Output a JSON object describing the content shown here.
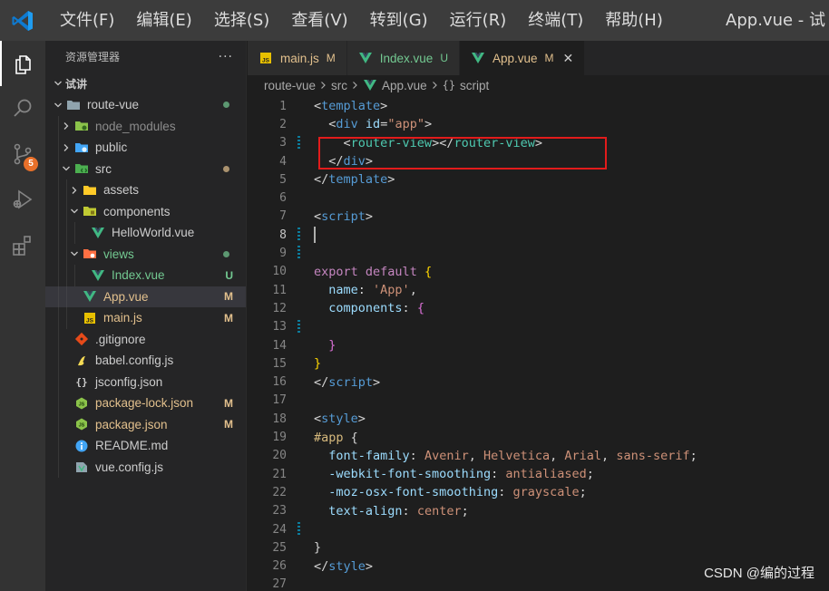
{
  "titlebar": {
    "menu": [
      "文件(F)",
      "编辑(E)",
      "选择(S)",
      "查看(V)",
      "转到(G)",
      "运行(R)",
      "终端(T)",
      "帮助(H)"
    ],
    "window_title": "App.vue - 试"
  },
  "activitybar": {
    "items": [
      "explorer-icon",
      "search-icon",
      "source-control-icon",
      "run-debug-icon",
      "extensions-icon"
    ],
    "scm_badge": "5"
  },
  "sidebar": {
    "title": "资源管理器",
    "more": "···",
    "workspace": "试讲",
    "tree": [
      {
        "label": "route-vue",
        "kind": "folder-open",
        "depth": 1,
        "icon": "folder-icon",
        "dot": "#73c991"
      },
      {
        "label": "node_modules",
        "kind": "folder",
        "depth": 2,
        "icon": "node-folder-icon",
        "dim": true
      },
      {
        "label": "public",
        "kind": "folder",
        "depth": 2,
        "icon": "public-folder-icon"
      },
      {
        "label": "src",
        "kind": "folder-open",
        "depth": 2,
        "icon": "src-folder-icon",
        "dot": "#e2c08d"
      },
      {
        "label": "assets",
        "kind": "folder",
        "depth": 3,
        "icon": "assets-folder-icon"
      },
      {
        "label": "components",
        "kind": "folder-open",
        "depth": 3,
        "icon": "components-folder-icon"
      },
      {
        "label": "HelloWorld.vue",
        "kind": "file",
        "depth": 4,
        "icon": "vue-file-icon"
      },
      {
        "label": "views",
        "kind": "folder-open",
        "depth": 3,
        "icon": "views-folder-icon",
        "git": "u",
        "dot": "#73c991"
      },
      {
        "label": "Index.vue",
        "kind": "file",
        "depth": 4,
        "icon": "vue-file-icon",
        "git": "u",
        "status": "U"
      },
      {
        "label": "App.vue",
        "kind": "file",
        "depth": 3,
        "icon": "vue-file-icon",
        "git": "m",
        "status": "M",
        "selected": true
      },
      {
        "label": "main.js",
        "kind": "file",
        "depth": 3,
        "icon": "js-file-icon",
        "git": "m",
        "status": "M"
      },
      {
        "label": ".gitignore",
        "kind": "file",
        "depth": 2,
        "icon": "git-file-icon"
      },
      {
        "label": "babel.config.js",
        "kind": "file",
        "depth": 2,
        "icon": "babel-file-icon"
      },
      {
        "label": "jsconfig.json",
        "kind": "file",
        "depth": 2,
        "icon": "json-file-icon"
      },
      {
        "label": "package-lock.json",
        "kind": "file",
        "depth": 2,
        "icon": "npm-file-icon",
        "git": "m",
        "status": "M"
      },
      {
        "label": "package.json",
        "kind": "file",
        "depth": 2,
        "icon": "npm-file-icon",
        "git": "m",
        "status": "M"
      },
      {
        "label": "README.md",
        "kind": "file",
        "depth": 2,
        "icon": "info-file-icon"
      },
      {
        "label": "vue.config.js",
        "kind": "file",
        "depth": 2,
        "icon": "vue-config-file-icon"
      }
    ]
  },
  "tabs": [
    {
      "label": "main.js",
      "icon": "js-file-icon",
      "status": "M",
      "git": "m"
    },
    {
      "label": "Index.vue",
      "icon": "vue-file-icon",
      "status": "U",
      "git": "u"
    },
    {
      "label": "App.vue",
      "icon": "vue-file-icon",
      "status": "M",
      "git": "m",
      "active": true,
      "close": "✕"
    }
  ],
  "breadcrumb": [
    "route-vue",
    "src",
    "App.vue",
    "script"
  ],
  "editor": {
    "current_line": 8,
    "lines": [
      [
        [
          "tok-br",
          "<"
        ],
        [
          "tok-tag",
          "template"
        ],
        [
          "tok-br",
          ">"
        ]
      ],
      [
        [
          "",
          "  "
        ],
        [
          "tok-br",
          "<"
        ],
        [
          "tok-tag",
          "div"
        ],
        [
          "",
          ""
        ],
        [
          "tok-attr",
          " id"
        ],
        [
          "tok-br",
          "="
        ],
        [
          "tok-str",
          "\"app\""
        ],
        [
          "tok-br",
          ">"
        ]
      ],
      [
        [
          "",
          "    "
        ],
        [
          "tok-br",
          "<"
        ],
        [
          "tok-tag2",
          "router-view"
        ],
        [
          "tok-br",
          "></"
        ],
        [
          "tok-tag2",
          "router-view"
        ],
        [
          "tok-br",
          ">"
        ]
      ],
      [
        [
          "",
          "  "
        ],
        [
          "tok-br",
          "</"
        ],
        [
          "tok-tag",
          "div"
        ],
        [
          "tok-br",
          ">"
        ]
      ],
      [
        [
          "tok-br",
          "</"
        ],
        [
          "tok-tag",
          "template"
        ],
        [
          "tok-br",
          ">"
        ]
      ],
      [],
      [
        [
          "tok-br",
          "<"
        ],
        [
          "tok-tag",
          "script"
        ],
        [
          "tok-br",
          ">"
        ]
      ],
      [],
      [],
      [
        [
          "tok-kw",
          "export"
        ],
        [
          "",
          " "
        ],
        [
          "tok-kw",
          "default"
        ],
        [
          "",
          " "
        ],
        [
          "tok-brace1",
          "{"
        ]
      ],
      [
        [
          "",
          "  "
        ],
        [
          "tok-prop",
          "name"
        ],
        [
          "tok-punc",
          ": "
        ],
        [
          "tok-val",
          "'App'"
        ],
        [
          "tok-punc",
          ","
        ]
      ],
      [
        [
          "",
          "  "
        ],
        [
          "tok-prop",
          "components"
        ],
        [
          "tok-punc",
          ": "
        ],
        [
          "tok-brace2",
          "{"
        ]
      ],
      [],
      [
        [
          "",
          "  "
        ],
        [
          "tok-brace2",
          "}"
        ]
      ],
      [
        [
          "tok-brace1",
          "}"
        ]
      ],
      [
        [
          "tok-br",
          "</"
        ],
        [
          "tok-tag",
          "script"
        ],
        [
          "tok-br",
          ">"
        ]
      ],
      [],
      [
        [
          "tok-br",
          "<"
        ],
        [
          "tok-tag",
          "style"
        ],
        [
          "tok-br",
          ">"
        ]
      ],
      [
        [
          "tok-sel",
          "#app"
        ],
        [
          "tok-punc",
          " {"
        ]
      ],
      [
        [
          "",
          "  "
        ],
        [
          "tok-prop",
          "font-family"
        ],
        [
          "tok-punc",
          ": "
        ],
        [
          "tok-cssval",
          "Avenir"
        ],
        [
          "tok-punc",
          ", "
        ],
        [
          "tok-cssval",
          "Helvetica"
        ],
        [
          "tok-punc",
          ", "
        ],
        [
          "tok-cssval",
          "Arial"
        ],
        [
          "tok-punc",
          ", "
        ],
        [
          "tok-cssval",
          "sans-serif"
        ],
        [
          "tok-punc",
          ";"
        ]
      ],
      [
        [
          "",
          "  "
        ],
        [
          "tok-prop",
          "-webkit-font-smoothing"
        ],
        [
          "tok-punc",
          ": "
        ],
        [
          "tok-cssval",
          "antialiased"
        ],
        [
          "tok-punc",
          ";"
        ]
      ],
      [
        [
          "",
          "  "
        ],
        [
          "tok-prop",
          "-moz-osx-font-smoothing"
        ],
        [
          "tok-punc",
          ": "
        ],
        [
          "tok-cssval",
          "grayscale"
        ],
        [
          "tok-punc",
          ";"
        ]
      ],
      [
        [
          "",
          "  "
        ],
        [
          "tok-prop",
          "text-align"
        ],
        [
          "tok-punc",
          ": "
        ],
        [
          "tok-cssval",
          "center"
        ],
        [
          "tok-punc",
          ";"
        ]
      ],
      [],
      [
        [
          "tok-punc",
          "}"
        ]
      ],
      [
        [
          "tok-br",
          "</"
        ],
        [
          "tok-tag",
          "style"
        ],
        [
          "tok-br",
          ">"
        ]
      ],
      []
    ],
    "gutter_marks": [
      3,
      8,
      9,
      13,
      24
    ]
  },
  "watermark": "CSDN @编的过程",
  "colors": {
    "accent_vue": "#41b883",
    "git_modified": "#e2c08d",
    "git_untracked": "#73c991",
    "highlight_box": "#e21b1b"
  }
}
